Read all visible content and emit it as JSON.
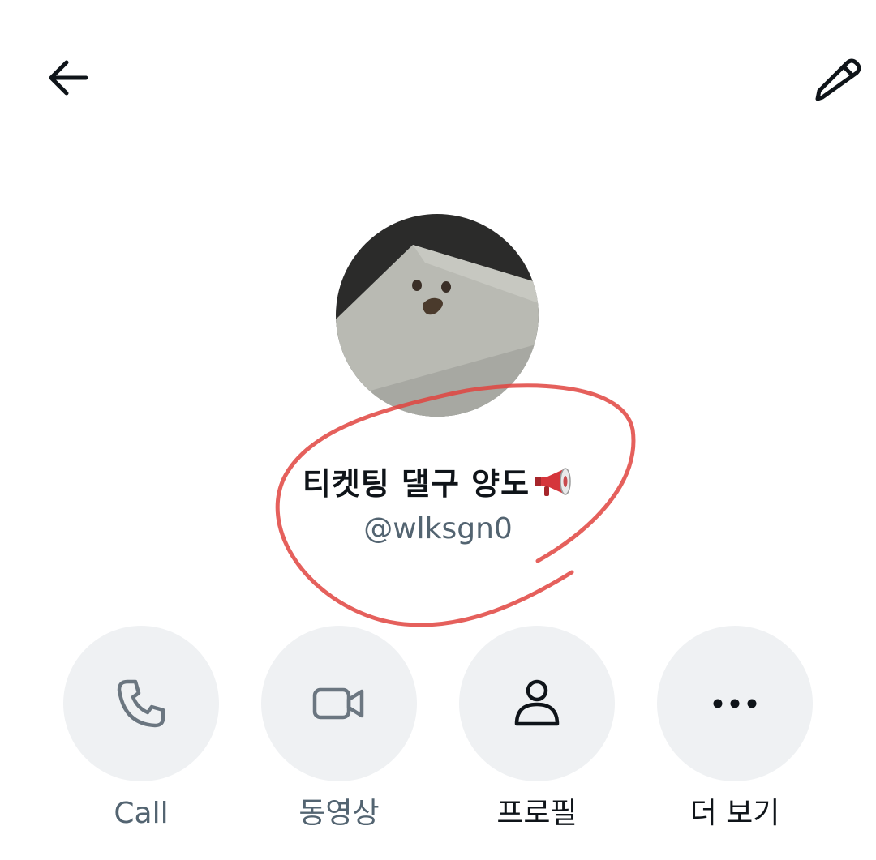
{
  "header": {
    "back_icon": "arrow-left-icon",
    "edit_icon": "pencil-icon"
  },
  "profile": {
    "display_name": "티켓팅 댈구 양도",
    "name_emoji": "megaphone-emoji",
    "handle": "@wlksgn0"
  },
  "actions": [
    {
      "label": "Call",
      "icon": "phone-icon",
      "enabled": false
    },
    {
      "label": "동영상",
      "icon": "video-camera-icon",
      "enabled": false
    },
    {
      "label": "프로필",
      "icon": "person-icon",
      "enabled": true
    },
    {
      "label": "더 보기",
      "icon": "more-dots-icon",
      "enabled": true
    }
  ],
  "colors": {
    "text_primary": "#0f1419",
    "text_secondary": "#536471",
    "button_bg": "#eff1f3",
    "disabled_icon": "#6b7680",
    "annotation_red": "#e0443f"
  }
}
